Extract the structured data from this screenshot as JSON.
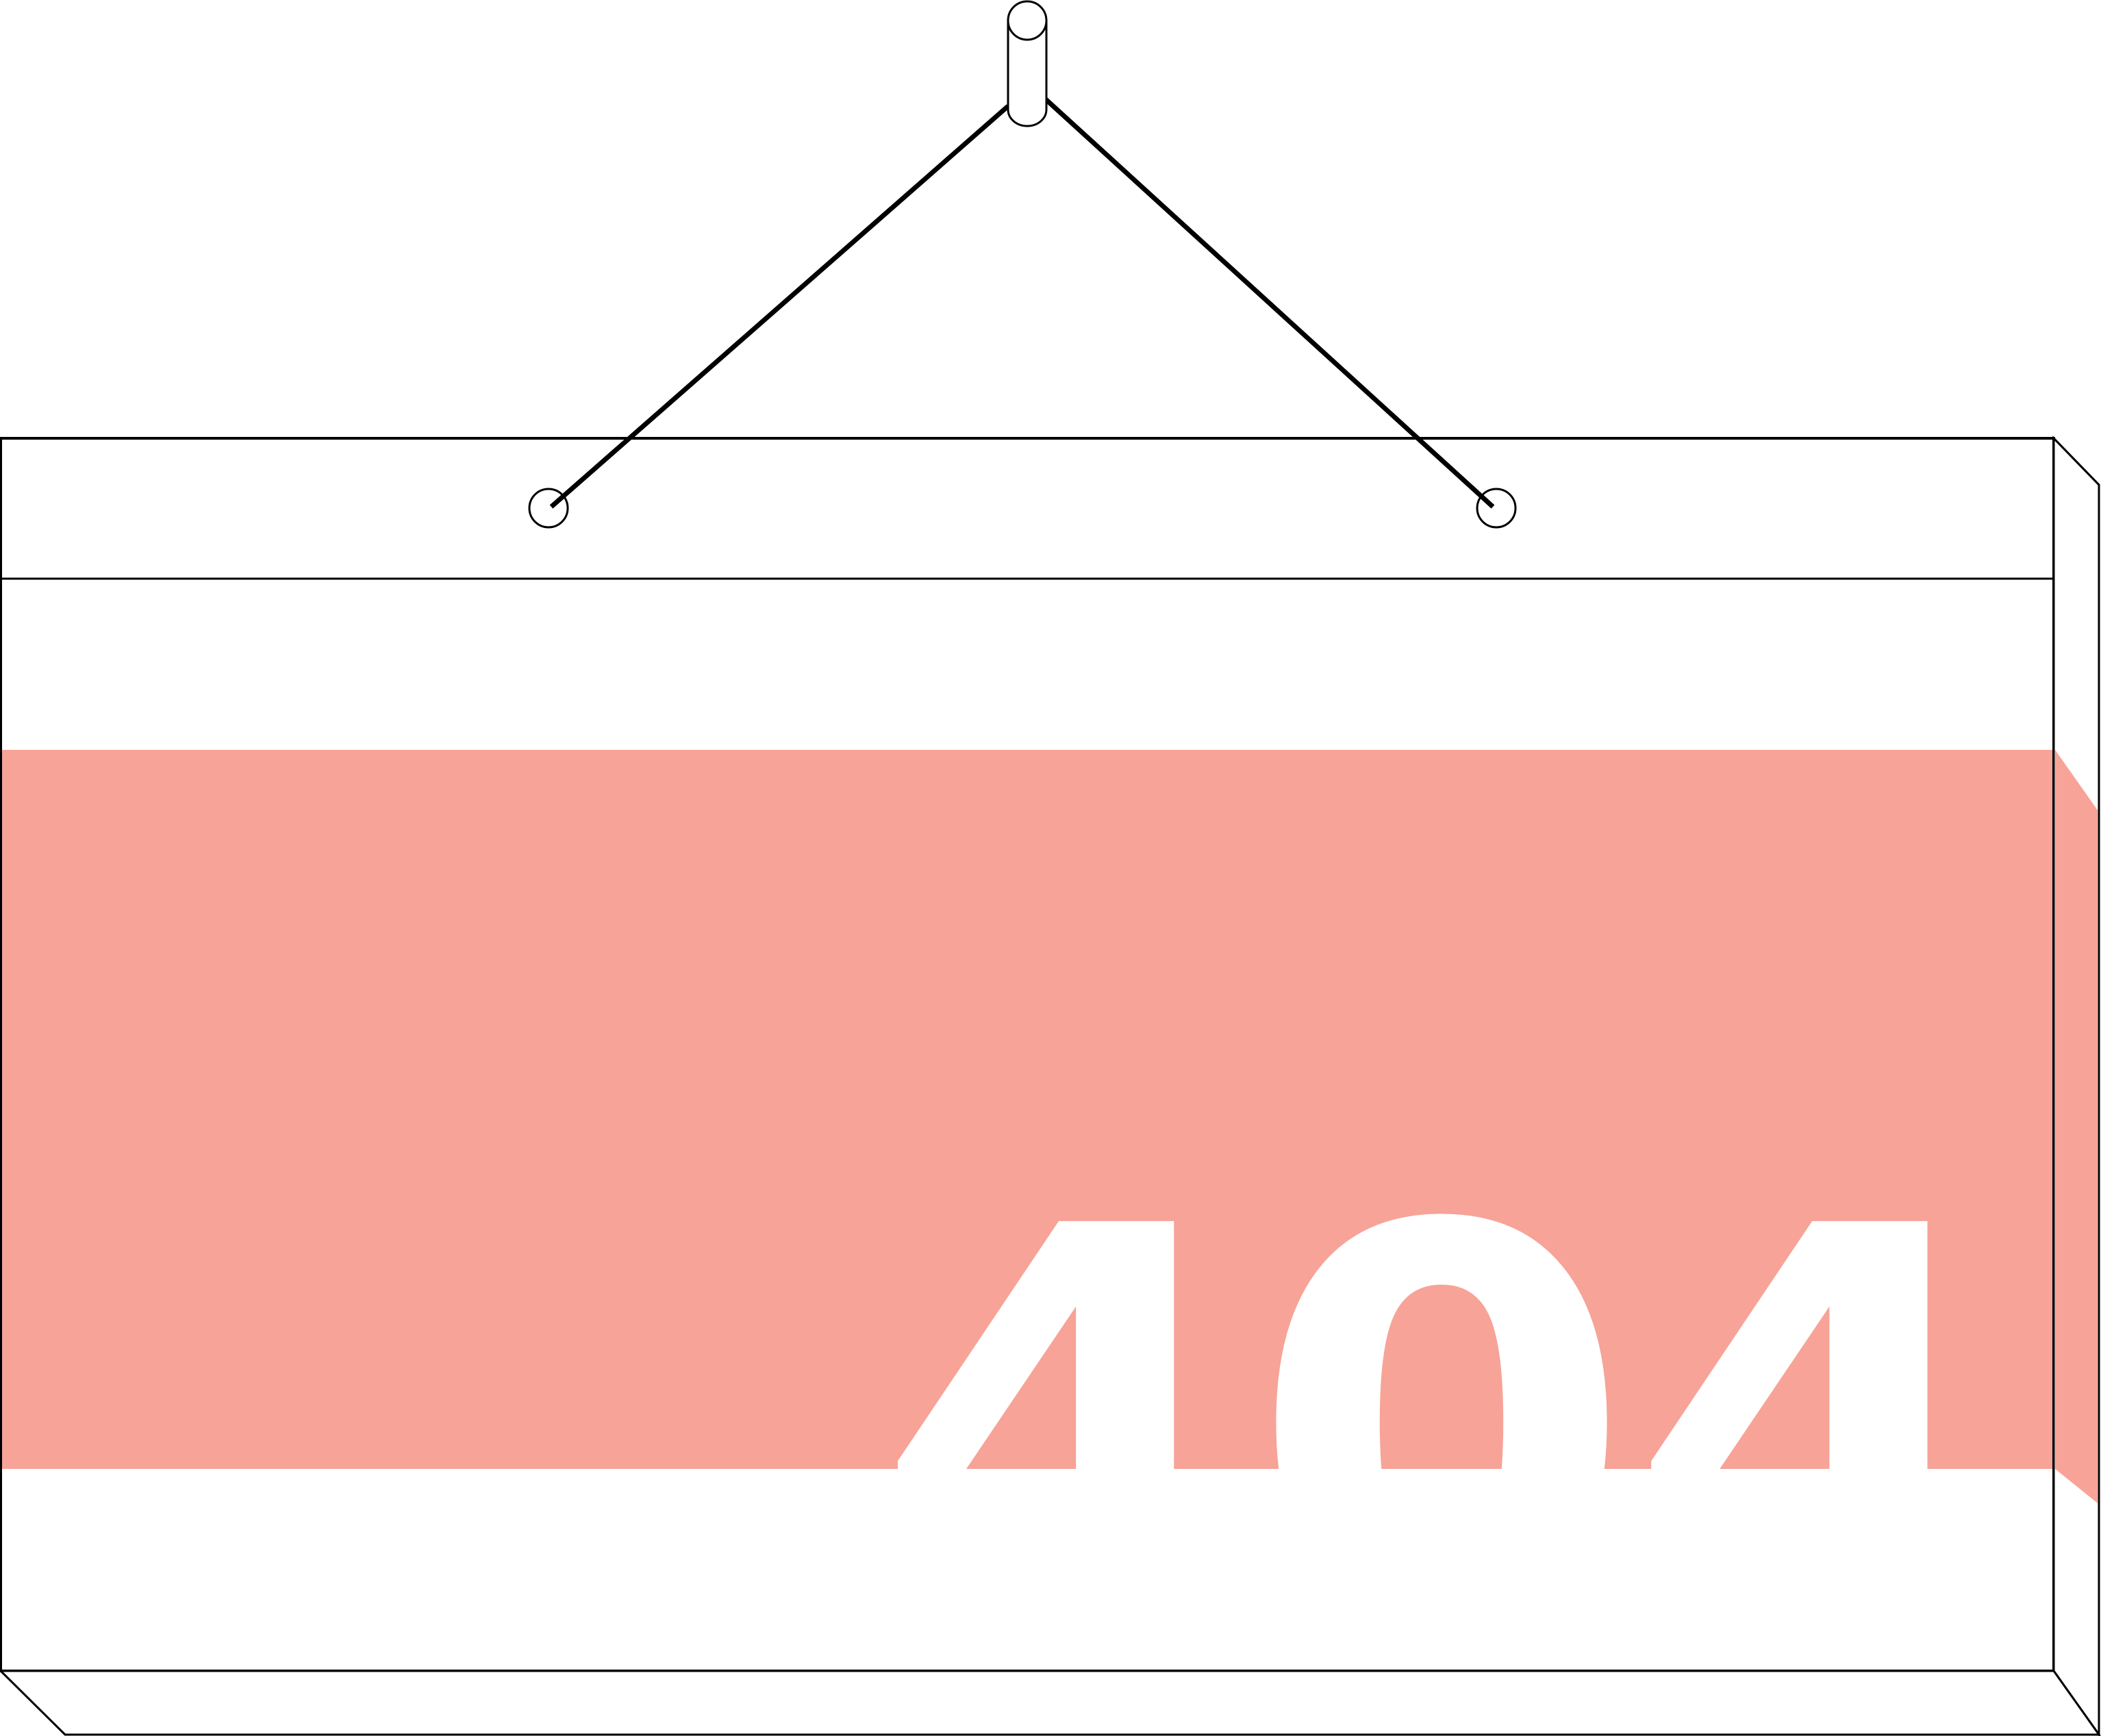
{
  "sign": {
    "error_code": "404",
    "band_color": "#f7a397",
    "text_color": "#ffffff",
    "line_color": "#000000"
  },
  "icons": {
    "nail": "wall-nail-icon",
    "holes": "eyelet-icon"
  }
}
